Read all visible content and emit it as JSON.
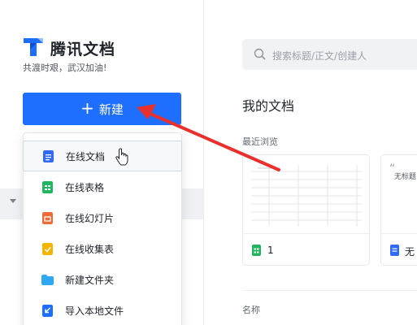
{
  "brand": {
    "name": "腾讯文档",
    "slogan": "共渡时艰，武汉加油!"
  },
  "new_button": {
    "label": "新建",
    "plus": "+"
  },
  "menu": {
    "items": [
      {
        "label": "在线文档",
        "icon": "doc-icon",
        "color": "#2f6bf6"
      },
      {
        "label": "在线表格",
        "icon": "sheet-icon",
        "color": "#20b55e"
      },
      {
        "label": "在线幻灯片",
        "icon": "slides-icon",
        "color": "#f06a35"
      },
      {
        "label": "在线收集表",
        "icon": "form-icon",
        "color": "#f5b400"
      },
      {
        "label": "新建文件夹",
        "icon": "folder-icon",
        "color": "#2fa8f3"
      },
      {
        "label": "导入本地文件",
        "icon": "import-icon",
        "color": "#1e6fff"
      }
    ]
  },
  "search": {
    "placeholder": "搜索标题/正文/创建人"
  },
  "main": {
    "section_title": "我的文档",
    "recent_label": "最近浏览",
    "cards": [
      {
        "name": "1",
        "icon": "sheet-icon"
      },
      {
        "name": "无",
        "preview_quote": "“",
        "preview_text": "无标题"
      }
    ],
    "name_column": "名称"
  },
  "colors": {
    "accent": "#1e6fff",
    "annotation_arrow": "#e8302d"
  }
}
